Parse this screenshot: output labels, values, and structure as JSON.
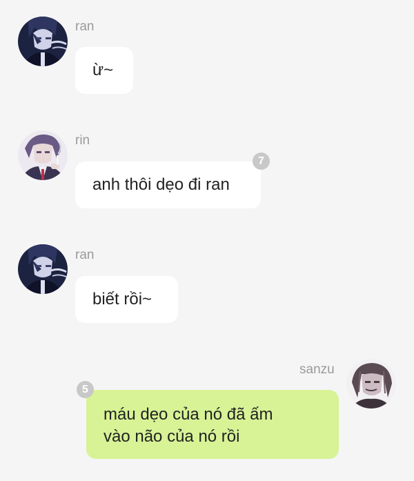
{
  "messages": [
    {
      "sender": "ran",
      "text": "ừ~",
      "avatar_icon": "ran-avatar-icon"
    },
    {
      "sender": "rin",
      "text": "anh thôi dẹo đi ran",
      "unread_count": "7",
      "avatar_icon": "rin-avatar-icon"
    },
    {
      "sender": "ran",
      "text": "biết rồi~",
      "avatar_icon": "ran-avatar-icon"
    },
    {
      "sender": "sanzu",
      "text": "máu dẹo của nó đã ấm\nvào não của nó rồi",
      "unread_count": "5",
      "avatar_icon": "sanzu-avatar-icon"
    }
  ],
  "colors": {
    "background": "#f5f5f5",
    "incoming_bubble": "#ffffff",
    "outgoing_bubble": "#d7f396",
    "sender_name": "#9a9a9a",
    "badge": "#c8c8c8"
  }
}
